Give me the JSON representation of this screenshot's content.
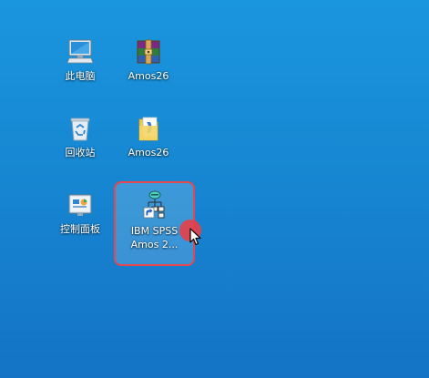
{
  "desktop": {
    "icons": [
      {
        "id": "this-pc",
        "label": "此电脑",
        "icon": "computer-icon"
      },
      {
        "id": "amos26-archive",
        "label": "Amos26",
        "icon": "winrar-archive-icon"
      },
      {
        "id": "recycle-bin",
        "label": "回收站",
        "icon": "recycle-bin-icon"
      },
      {
        "id": "amos26-folder",
        "label": "Amos26",
        "icon": "folder-icon"
      },
      {
        "id": "control-panel",
        "label": "控制面板",
        "icon": "control-panel-icon"
      },
      {
        "id": "ibm-spss-amos",
        "label_line1": "IBM SPSS",
        "label_line2": "Amos 2...",
        "icon": "amos-shortcut-icon",
        "selected": true
      }
    ]
  },
  "colors": {
    "desktop_top": "#1a96de",
    "desktop_bottom": "#1473c5",
    "highlight": "#e5484f"
  }
}
